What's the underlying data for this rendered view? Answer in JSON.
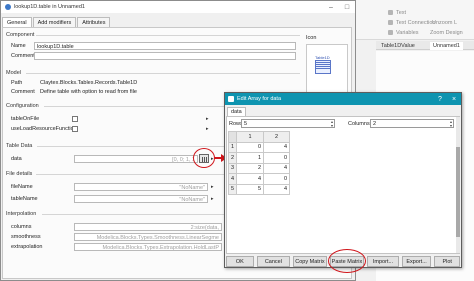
{
  "bg_app": {
    "tools": [
      "Text",
      "Text Connection",
      "Variables",
      "Zoom Design",
      "Unzoom L"
    ],
    "tabs": [
      "Table1DValue",
      "Unnamed1"
    ]
  },
  "main_dialog": {
    "title": "lookup1D.table in Unnamed1",
    "tabs": [
      "General",
      "Add modifiers",
      "Attributes"
    ],
    "component": {
      "section": "Component",
      "name_label": "Name",
      "name_value": "lookup1D.table",
      "comment_label": "Comment",
      "comment_value": "",
      "icon_label": "Icon",
      "icon_caption": "Table1D"
    },
    "model": {
      "section": "Model",
      "path_label": "Path",
      "path_value": "Claytex.Blocks.Tables.Records.Table1D",
      "comment_label": "Comment",
      "comment_value": "Define table with option to read from file"
    },
    "configuration": {
      "section": "Configuration",
      "rows": [
        {
          "label": "tableOnFile"
        },
        {
          "label": "useLoadResourceFunction"
        }
      ]
    },
    "table_data": {
      "section": "Table Data",
      "data_label": "data",
      "data_value": "[0, 0; 1, 1"
    },
    "file_details": {
      "section": "File details",
      "fileName_label": "fileName",
      "fileName_value": "\"NoName\"",
      "tableName_label": "tableName",
      "tableName_value": "\"NoName\""
    },
    "interpolation": {
      "section": "Interpolation",
      "columns_label": "columns",
      "columns_value": "2:size(data,",
      "smoothness_label": "smoothness",
      "smoothness_value": "Modelica.Blocks.Types.Smoothness.LinearSegme",
      "extrapolation_label": "extrapolation",
      "extrapolation_value": "Modelica.Blocks.Types.Extrapolation.HoldLastP"
    }
  },
  "array_dialog": {
    "title": "Edit Array for data",
    "tab": "data",
    "rows_label": "Rows",
    "rows_value": "5",
    "columns_label": "Columns",
    "columns_value": "2",
    "column_headers": [
      "1",
      "2"
    ],
    "row_headers": [
      "1",
      "2",
      "3",
      "4",
      "5"
    ],
    "cells": [
      [
        "0",
        "4"
      ],
      [
        "1",
        "0"
      ],
      [
        "2",
        "4"
      ],
      [
        "4",
        "0"
      ],
      [
        "5",
        "4"
      ]
    ],
    "buttons": [
      "OK",
      "Cancel",
      "Copy Matrix",
      "Paste Matrix",
      "Import...",
      "Export...",
      "Plot"
    ]
  },
  "colors": {
    "title_bar": "#0e94b0",
    "annotation": "#d0151b"
  }
}
